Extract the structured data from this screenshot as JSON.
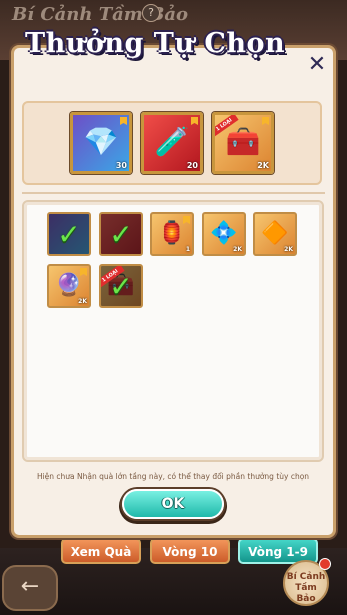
{
  "background": {
    "title": "Bí Cảnh Tầm Bảo",
    "help_icon": "?",
    "back_icon": "←",
    "bottom_buttons": [
      "Xem Quà",
      "Vòng 10",
      "Vòng 1-9"
    ],
    "corner_button": "Bí Cảnh Tầm Bảo"
  },
  "modal": {
    "title": "Thưởng Tự Chọn",
    "close_icon": "✕",
    "selected_rewards": [
      {
        "icon": "purple-crystal-icon",
        "count": "30"
      },
      {
        "icon": "red-gourd-icon",
        "count": "20"
      },
      {
        "icon": "treasure-chest-icon",
        "count": "2K",
        "badge": "1 LOẠI"
      }
    ],
    "pool_items": [
      {
        "icon": "item-icon",
        "count": "",
        "state": "selected"
      },
      {
        "icon": "item-icon",
        "count": "",
        "state": "selected"
      },
      {
        "icon": "lantern-icon",
        "count": "1",
        "state": "available"
      },
      {
        "icon": "teal-crystal-icon",
        "count": "2K",
        "state": "available"
      },
      {
        "icon": "gold-crystal-icon",
        "count": "2K",
        "state": "available"
      },
      {
        "icon": "purple-crystal-icon",
        "count": "2K",
        "state": "available"
      },
      {
        "icon": "chest-icon",
        "count": "",
        "state": "selected",
        "badge": "1 LOẠI"
      }
    ],
    "note": "Hiện chưa Nhận quà lớn tầng này, có thể thay đổi phần thưởng tùy chọn",
    "ok_label": "OK"
  },
  "colors": {
    "accent_teal": "#1fb9aa",
    "accent_orange": "#dc8431",
    "title_outline": "#2c2150"
  }
}
